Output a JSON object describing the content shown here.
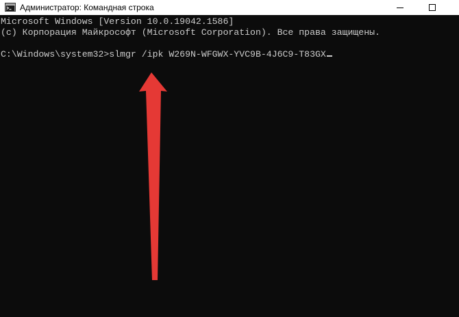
{
  "window": {
    "title": "Администратор: Командная строка",
    "icon": "cmd-icon"
  },
  "controls": {
    "minimize_icon": "minimize-icon",
    "maximize_icon": "maximize-icon"
  },
  "console": {
    "line1": "Microsoft Windows [Version 10.0.19042.1586]",
    "line2": "(c) Корпорация Майкрософт (Microsoft Corporation). Все права защищены.",
    "prompt": "C:\\Windows\\system32>",
    "command": "slmgr /ipk W269N-WFGWX-YVC9B-4J6C9-T83GX"
  },
  "annotation": {
    "color": "#e53935"
  }
}
